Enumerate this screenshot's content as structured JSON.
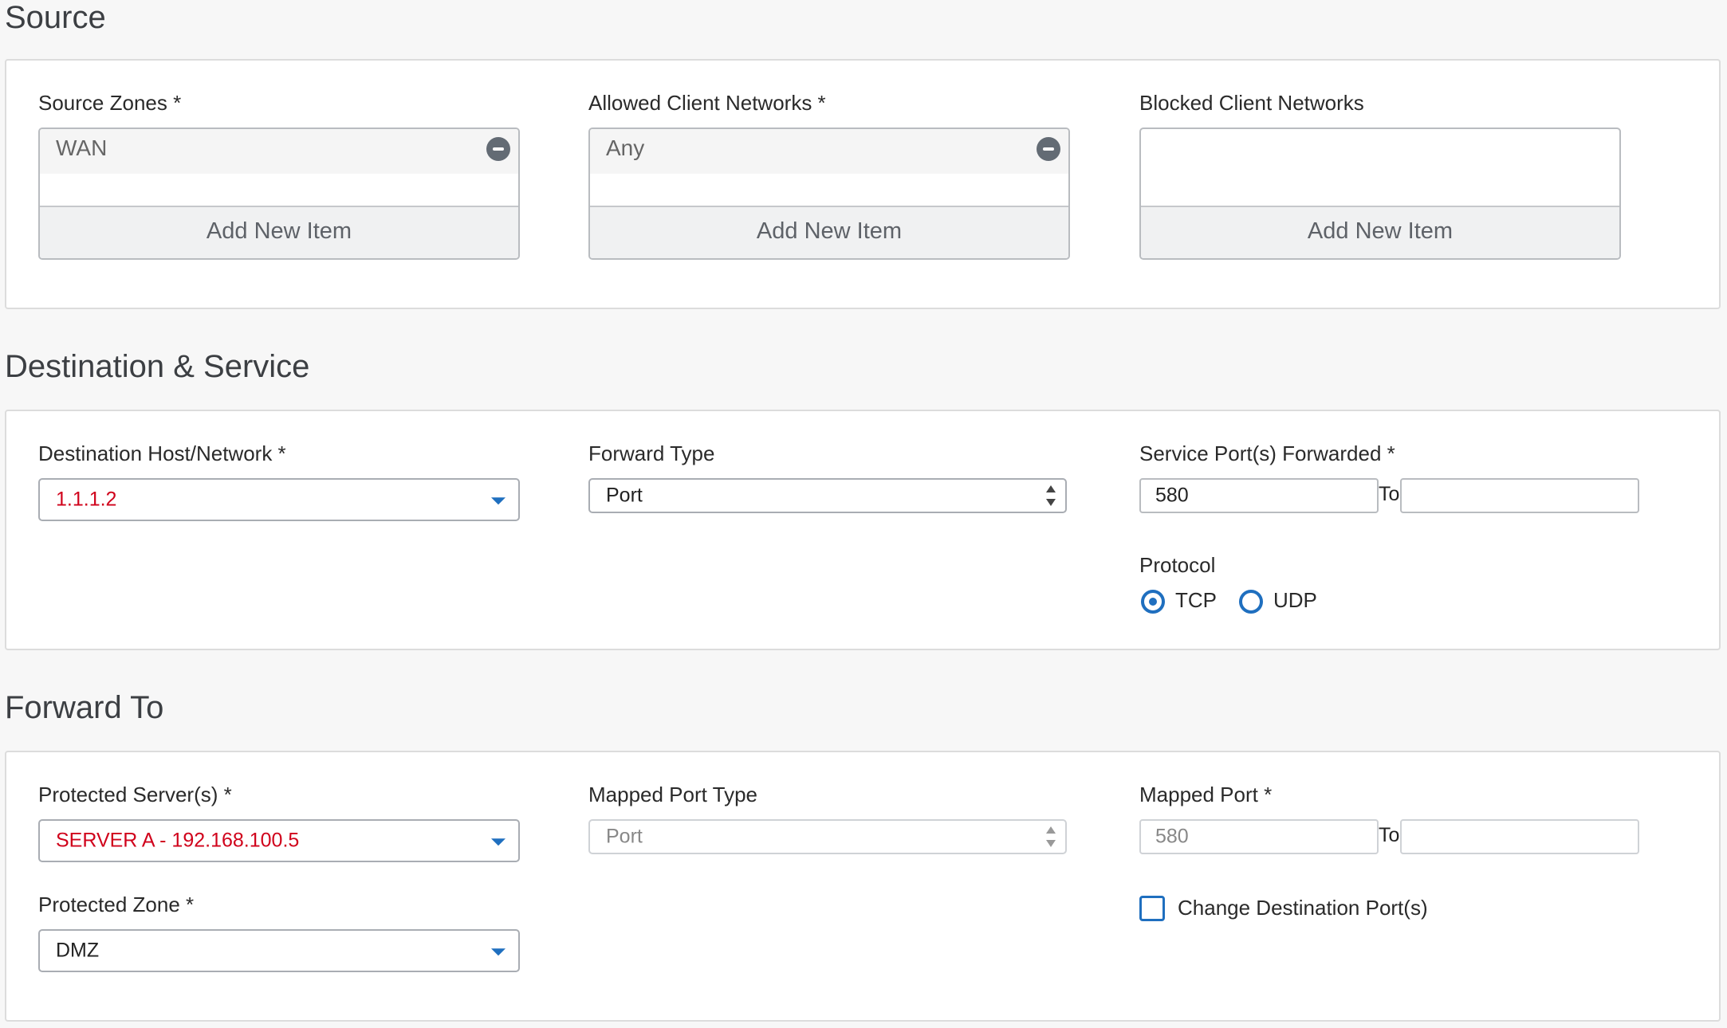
{
  "sections": {
    "source": "Source",
    "destination": "Destination & Service",
    "forward": "Forward To"
  },
  "source": {
    "source_zones": {
      "label": "Source Zones *",
      "items": [
        "WAN"
      ],
      "add_label": "Add New Item"
    },
    "allowed_networks": {
      "label": "Allowed Client Networks *",
      "items": [
        "Any"
      ],
      "add_label": "Add New Item"
    },
    "blocked_networks": {
      "label": "Blocked Client Networks",
      "items": [],
      "add_label": "Add New Item"
    }
  },
  "destination": {
    "host": {
      "label": "Destination Host/Network *",
      "value": "1.1.1.2"
    },
    "forward_type": {
      "label": "Forward Type",
      "value": "Port"
    },
    "service_ports": {
      "label": "Service Port(s) Forwarded *",
      "from": "580",
      "to_label": "To",
      "to": ""
    },
    "protocol": {
      "label": "Protocol",
      "options": [
        "TCP",
        "UDP"
      ],
      "selected": "TCP"
    }
  },
  "forward": {
    "servers": {
      "label": "Protected Server(s) *",
      "value": "SERVER A - 192.168.100.5"
    },
    "zone": {
      "label": "Protected Zone *",
      "value": "DMZ"
    },
    "mapped_port_type": {
      "label": "Mapped Port Type",
      "value": "Port"
    },
    "mapped_port": {
      "label": "Mapped Port *",
      "from": "580",
      "to_label": "To",
      "to": ""
    },
    "change_dest": {
      "label": "Change Destination Port(s)",
      "checked": false
    }
  },
  "colors": {
    "accent": "#1f6fbf",
    "error": "#d0021b"
  }
}
